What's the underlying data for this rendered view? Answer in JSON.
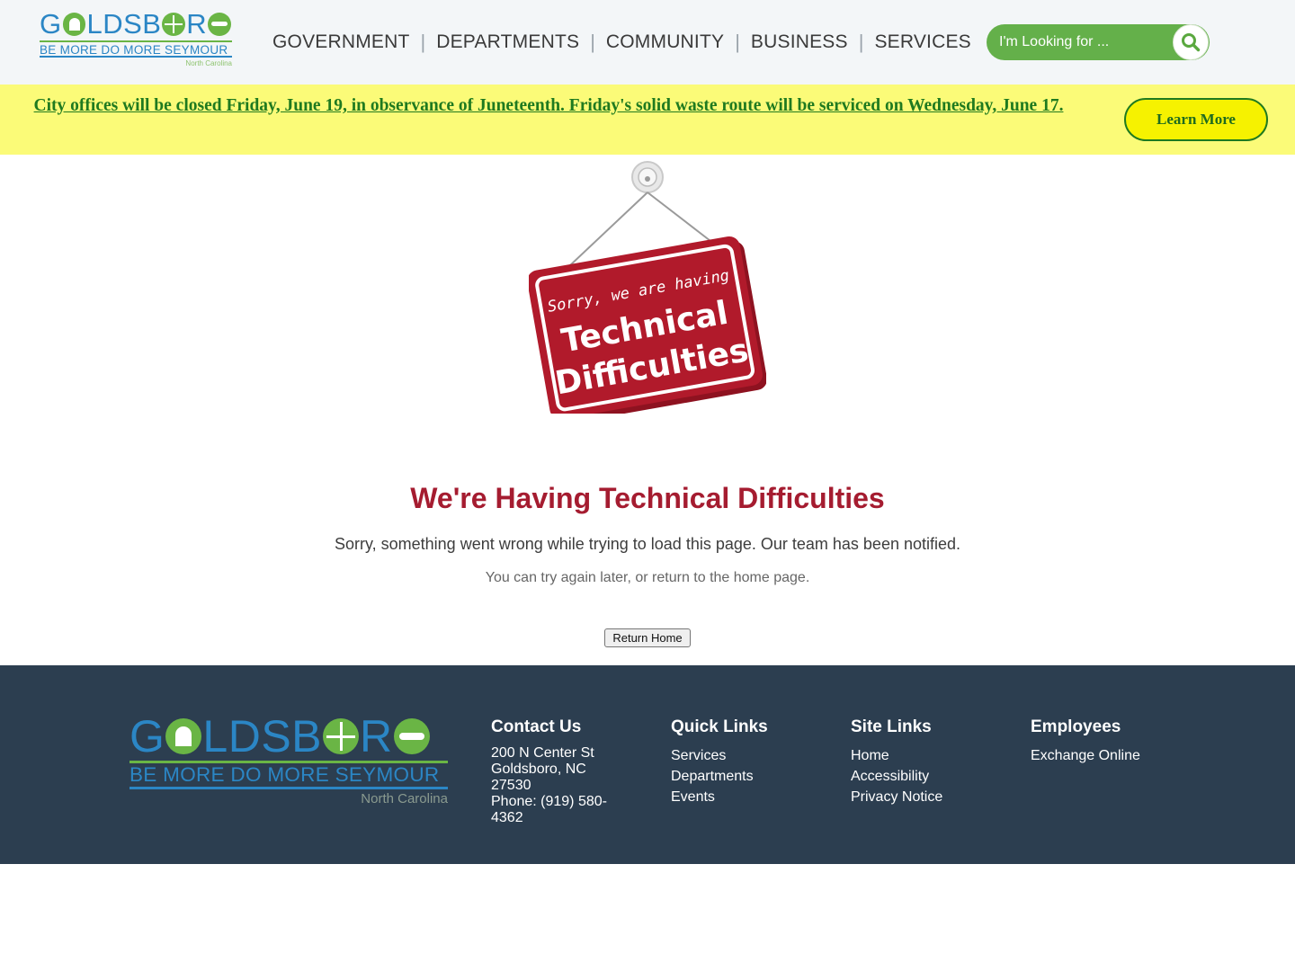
{
  "header": {
    "logo": {
      "word_left": "G",
      "word_mid": "LDSB",
      "word_right": "R",
      "tagline": "BE MORE  DO MORE  SEYMOUR",
      "state": "North Carolina"
    },
    "nav": [
      {
        "label": "GOVERNMENT"
      },
      {
        "label": "DEPARTMENTS"
      },
      {
        "label": "COMMUNITY"
      },
      {
        "label": "BUSINESS"
      },
      {
        "label": "SERVICES"
      }
    ],
    "search": {
      "placeholder": "I'm Looking for ...",
      "icon": "search-icon"
    }
  },
  "alert": {
    "text": "City offices will be closed Friday, June 19, in observance of Juneteenth. Friday's solid waste route will be serviced on Wednesday, June 17.",
    "button_label": "Learn More"
  },
  "main": {
    "sign": {
      "line1": "Sorry, we are having",
      "line2": "Technical",
      "line3": "Difficulties"
    },
    "title": "We're Having Technical Difficulties",
    "message": "Sorry, something went wrong while trying to load this page. Our team has been notified.",
    "hint": "You can try again later, or return to the home page.",
    "button_label": "Return Home"
  },
  "footer": {
    "logo": {
      "word_left": "G",
      "word_mid": "LDSB",
      "word_right": "R",
      "tagline": "BE MORE  DO MORE  SEYMOUR",
      "state": "North Carolina"
    },
    "contact": {
      "heading": "Contact Us",
      "street": "200 N Center St",
      "city": "Goldsboro, NC",
      "zip": "27530",
      "phone": "Phone: (919) 580-4362"
    },
    "quick_links": {
      "heading": "Quick Links",
      "items": [
        "Services",
        "Departments",
        "Events"
      ]
    },
    "site_links": {
      "heading": "Site Links",
      "items": [
        "Home",
        "Accessibility",
        "Privacy Notice"
      ]
    },
    "employees": {
      "heading": "Employees",
      "items": [
        "Exchange Online"
      ]
    }
  },
  "colors": {
    "brand_blue": "#2b86c5",
    "brand_green": "#6ab545",
    "alert_bg": "#fbfb78",
    "alert_text": "#1f7a1f",
    "error_red": "#a51c30",
    "footer_bg": "#2c3e50",
    "sign_red": "#b11a2b"
  }
}
